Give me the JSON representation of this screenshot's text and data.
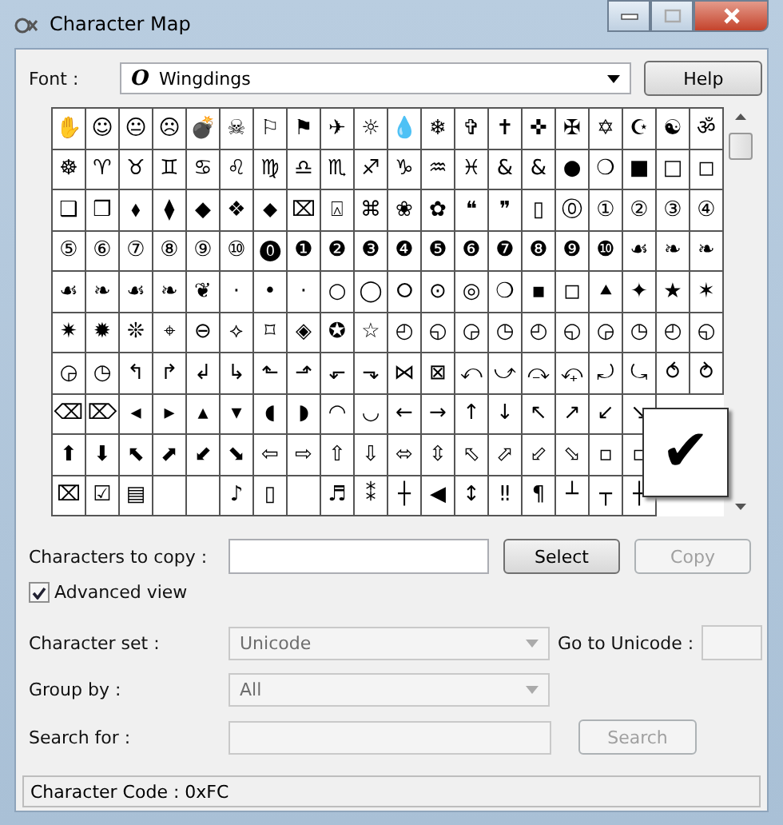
{
  "window": {
    "title": "Character Map"
  },
  "font": {
    "label": "Font :",
    "value": "Wingdings",
    "glyph": "O"
  },
  "help_button": "Help",
  "grid": [
    [
      {
        "char": "✋"
      },
      {
        "char": "☺"
      },
      {
        "char": "😐"
      },
      {
        "char": "☹"
      },
      {
        "char": "💣"
      },
      {
        "char": "☠"
      },
      {
        "char": "⚐"
      },
      {
        "char": "⚑"
      },
      {
        "char": "✈"
      },
      {
        "char": "☼"
      },
      {
        "char": "💧"
      },
      {
        "char": "❄"
      },
      {
        "char": "✞"
      },
      {
        "char": "✝"
      },
      {
        "char": "✜"
      },
      {
        "char": "✠"
      },
      {
        "char": "✡"
      },
      {
        "char": "☪"
      },
      {
        "char": "☯"
      },
      {
        "char": "ॐ"
      }
    ],
    [
      {
        "char": "☸"
      },
      {
        "char": "♈"
      },
      {
        "char": "♉"
      },
      {
        "char": "♊"
      },
      {
        "char": "♋"
      },
      {
        "char": "♌"
      },
      {
        "char": "♍"
      },
      {
        "char": "♎"
      },
      {
        "char": "♏"
      },
      {
        "char": "♐"
      },
      {
        "char": "♑"
      },
      {
        "char": "♒"
      },
      {
        "char": "♓"
      },
      {
        "char": "&"
      },
      {
        "char": "&"
      },
      {
        "char": "●"
      },
      {
        "char": "❍"
      },
      {
        "char": "■"
      },
      {
        "char": "□"
      },
      {
        "char": "◻"
      }
    ],
    [
      {
        "char": "❑"
      },
      {
        "char": "❒"
      },
      {
        "char": "⬧"
      },
      {
        "char": "⧫"
      },
      {
        "char": "◆"
      },
      {
        "char": "❖"
      },
      {
        "char": "⬥"
      },
      {
        "char": "⌧"
      },
      {
        "char": "⍓"
      },
      {
        "char": "⌘"
      },
      {
        "char": "❀"
      },
      {
        "char": "✿"
      },
      {
        "char": "❝"
      },
      {
        "char": "❞"
      },
      {
        "char": "▯"
      },
      {
        "char": "⓪"
      },
      {
        "char": "①"
      },
      {
        "char": "②"
      },
      {
        "char": "③"
      },
      {
        "char": "④"
      }
    ],
    [
      {
        "char": "⑤"
      },
      {
        "char": "⑥"
      },
      {
        "char": "⑦"
      },
      {
        "char": "⑧"
      },
      {
        "char": "⑨"
      },
      {
        "char": "⑩"
      },
      {
        "char": "⓿"
      },
      {
        "char": "❶"
      },
      {
        "char": "❷"
      },
      {
        "char": "❸"
      },
      {
        "char": "❹"
      },
      {
        "char": "❺"
      },
      {
        "char": "❻"
      },
      {
        "char": "❼"
      },
      {
        "char": "❽"
      },
      {
        "char": "❾"
      },
      {
        "char": "❿"
      },
      {
        "char": "☙"
      },
      {
        "char": "❧"
      },
      {
        "char": "❧"
      }
    ],
    [
      {
        "char": "☙"
      },
      {
        "char": "❧"
      },
      {
        "char": "☙"
      },
      {
        "char": "❧"
      },
      {
        "char": "❦"
      },
      {
        "char": "·"
      },
      {
        "char": "•"
      },
      {
        "char": "·"
      },
      {
        "char": "○"
      },
      {
        "char": "◯"
      },
      {
        "char": "⭘"
      },
      {
        "char": "⊙"
      },
      {
        "char": "◎"
      },
      {
        "char": "❍"
      },
      {
        "char": "▪"
      },
      {
        "char": "◻"
      },
      {
        "char": "⯅"
      },
      {
        "char": "✦"
      },
      {
        "char": "★"
      },
      {
        "char": "✶"
      }
    ],
    [
      {
        "char": "✷"
      },
      {
        "char": "✹"
      },
      {
        "char": "❊"
      },
      {
        "char": "⌖"
      },
      {
        "char": "⊖"
      },
      {
        "char": "⟡"
      },
      {
        "char": "⌑"
      },
      {
        "char": "◈"
      },
      {
        "char": "✪"
      },
      {
        "char": "☆"
      },
      {
        "char": "◴"
      },
      {
        "char": "◵"
      },
      {
        "char": "◶"
      },
      {
        "char": "◷"
      },
      {
        "char": "◴"
      },
      {
        "char": "◵"
      },
      {
        "char": "◶"
      },
      {
        "char": "◷"
      },
      {
        "char": "◴"
      },
      {
        "char": "◵"
      }
    ],
    [
      {
        "char": "◶"
      },
      {
        "char": "◷"
      },
      {
        "char": "↰"
      },
      {
        "char": "↱"
      },
      {
        "char": "↲"
      },
      {
        "char": "↳"
      },
      {
        "char": "⬑"
      },
      {
        "char": "⬏"
      },
      {
        "char": "⬐"
      },
      {
        "char": "⬎"
      },
      {
        "char": "⋈"
      },
      {
        "char": "⊠"
      },
      {
        "char": "⤺"
      },
      {
        "char": "⤻"
      },
      {
        "char": "⤼"
      },
      {
        "char": "⤽"
      },
      {
        "char": "⤾"
      },
      {
        "char": "⤿"
      },
      {
        "char": "⥀"
      },
      {
        "char": "⥁"
      }
    ],
    [
      {
        "char": "⌫"
      },
      {
        "char": "⌦"
      },
      {
        "char": "◂"
      },
      {
        "char": "▸"
      },
      {
        "char": "▴"
      },
      {
        "char": "▾"
      },
      {
        "char": "◖"
      },
      {
        "char": "◗"
      },
      {
        "char": "◠"
      },
      {
        "char": "◡"
      },
      {
        "char": "←"
      },
      {
        "char": "→"
      },
      {
        "char": "↑"
      },
      {
        "char": "↓"
      },
      {
        "char": "↖"
      },
      {
        "char": "↗"
      },
      {
        "char": "↙"
      },
      {
        "char": "↘"
      }
    ],
    [
      {
        "char": "⬆"
      },
      {
        "char": "⬇"
      },
      {
        "char": "⬉"
      },
      {
        "char": "⬈"
      },
      {
        "char": "⬋"
      },
      {
        "char": "⬊"
      },
      {
        "char": "⇦"
      },
      {
        "char": "⇨"
      },
      {
        "char": "⇧"
      },
      {
        "char": "⇩"
      },
      {
        "char": "⬄"
      },
      {
        "char": "⇳"
      },
      {
        "char": "⬁"
      },
      {
        "char": "⬀"
      },
      {
        "char": "⬃"
      },
      {
        "char": "⬂"
      },
      {
        "char": "▫"
      },
      {
        "char": "▫"
      }
    ],
    [
      {
        "char": "⌧"
      },
      {
        "char": "☑"
      },
      {
        "char": "▤"
      },
      {
        "kind": "blank"
      },
      {
        "kind": "blank"
      },
      {
        "char": "♪"
      },
      {
        "char": "▯"
      },
      {
        "kind": "blank"
      },
      {
        "char": "♬"
      },
      {
        "char": "⁑"
      },
      {
        "char": "┼"
      },
      {
        "char": "◀"
      },
      {
        "char": "↕"
      },
      {
        "char": "‼"
      },
      {
        "char": "¶"
      },
      {
        "char": "┴"
      },
      {
        "char": "┬"
      },
      {
        "char": "┼"
      }
    ]
  ],
  "magnified_character": "✔",
  "copy": {
    "label": "Characters to copy :",
    "select_button": "Select",
    "copy_button": {
      "label": "Copy",
      "disabled": true
    }
  },
  "advanced_view": {
    "label": "Advanced view",
    "checked": true
  },
  "character_set": {
    "label": "Character set :",
    "value": "Unicode",
    "disabled": true
  },
  "go_to_unicode": {
    "label": "Go to Unicode :",
    "disabled": true
  },
  "group_by": {
    "label": "Group by :",
    "value": "All",
    "disabled": true
  },
  "search": {
    "label": "Search for :",
    "button": "Search",
    "disabled": true
  },
  "status_bar": "Character Code : 0xFC"
}
